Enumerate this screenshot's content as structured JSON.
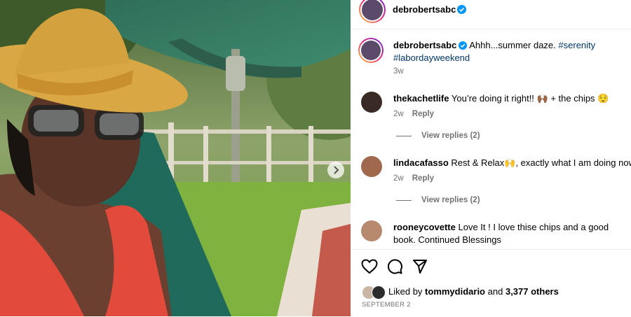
{
  "post": {
    "author": "debrobertsabc",
    "caption_text": "Ahhh...summer daze.",
    "hashtag_1": "#serenity",
    "hashtag_2": "#labordayweekend",
    "time": "3w"
  },
  "comments": [
    {
      "user": "thekachetlife",
      "text": "You’re doing it right!! 🙌🏾 + the chips 😌",
      "time": "2w",
      "reply": "Reply",
      "view_replies": "View replies (2)"
    },
    {
      "user": "lindacafasso",
      "text": "Rest & Relax🙌, exactly what I am doing now⚡",
      "time": "2w",
      "reply": "Reply",
      "view_replies": "View replies (2)"
    },
    {
      "user": "rooneycovette",
      "text": "Love It ! I love thise chips and a good book. Continued Blessings"
    }
  ],
  "likes": {
    "prefix": "Liked by",
    "user": "tommydidario",
    "and": "and",
    "count": "3,377 others"
  },
  "date": "SEPTEMBER 2",
  "icons": [
    "heart-icon",
    "comment-icon",
    "share-icon",
    "verified-icon",
    "chevron-right-icon"
  ],
  "colors": {
    "hashtag": "#00376b",
    "verified": "#0095f6",
    "meta": "#737373"
  }
}
